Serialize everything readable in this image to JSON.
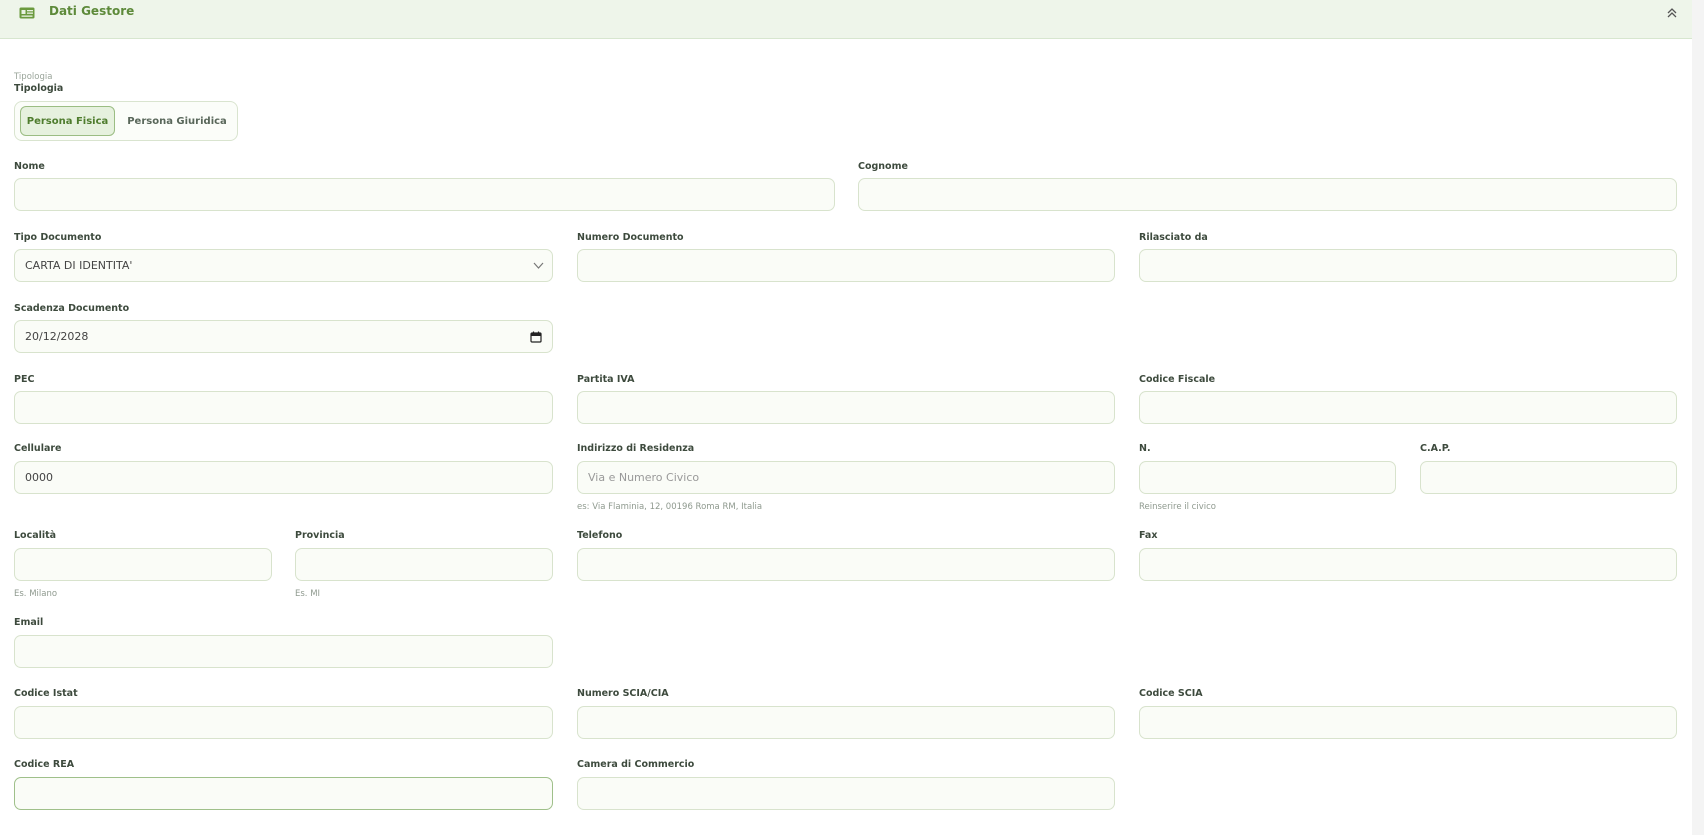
{
  "header": {
    "title": "Dati Gestore",
    "icon": "id-card-icon",
    "collapse_icon": "chevrons-up-icon"
  },
  "tipologia": {
    "small_label": "Tipologia",
    "label": "Tipologia",
    "options": [
      "Persona Fisica",
      "Persona Giuridica"
    ],
    "selected": "Persona Fisica"
  },
  "fields": {
    "nome": {
      "label": "Nome",
      "value": ""
    },
    "cognome": {
      "label": "Cognome",
      "value": ""
    },
    "tipo_documento": {
      "label": "Tipo Documento",
      "value": "CARTA DI IDENTITA'"
    },
    "numero_documento": {
      "label": "Numero Documento",
      "value": ""
    },
    "rilasciato_da": {
      "label": "Rilasciato da",
      "value": ""
    },
    "scadenza_documento": {
      "label": "Scadenza Documento",
      "value": "20/12/2028"
    },
    "pec": {
      "label": "PEC",
      "value": ""
    },
    "partita_iva": {
      "label": "Partita IVA",
      "value": ""
    },
    "codice_fiscale": {
      "label": "Codice Fiscale",
      "value": ""
    },
    "cellulare": {
      "label": "Cellulare",
      "value": "0000"
    },
    "indirizzo": {
      "label": "Indirizzo di Residenza",
      "placeholder": "Via e Numero Civico",
      "hint": "es: Via Flaminia, 12, 00196 Roma RM, Italia"
    },
    "civico": {
      "label": "N.",
      "value": "",
      "hint": "Reinserire il civico"
    },
    "cap": {
      "label": "C.A.P.",
      "value": ""
    },
    "localita": {
      "label": "Località",
      "value": "",
      "hint": "Es. Milano"
    },
    "provincia": {
      "label": "Provincia",
      "value": "",
      "hint": "Es. MI"
    },
    "telefono": {
      "label": "Telefono",
      "value": ""
    },
    "fax": {
      "label": "Fax",
      "value": ""
    },
    "email": {
      "label": "Email",
      "value": ""
    },
    "codice_istat": {
      "label": "Codice Istat",
      "value": ""
    },
    "numero_scia": {
      "label": "Numero SCIA/CIA",
      "value": ""
    },
    "codice_scia": {
      "label": "Codice SCIA",
      "value": ""
    },
    "codice_rea": {
      "label": "Codice REA",
      "value": ""
    },
    "camera_commercio": {
      "label": "Camera di Commercio",
      "value": ""
    }
  },
  "colors": {
    "accent": "#5d8a3a",
    "header_bg": "#eef5ea",
    "input_bg": "#fafcf7",
    "input_border": "#d8e3cd"
  }
}
